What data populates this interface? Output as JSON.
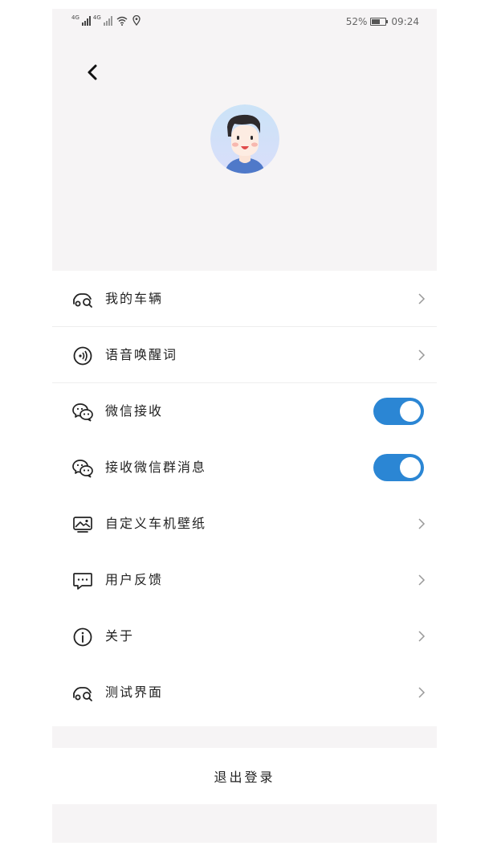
{
  "status_bar": {
    "network_1": "4G",
    "network_2": "4G",
    "battery_level": "52%",
    "battery_fraction": 0.52,
    "time": "09:24"
  },
  "header": {
    "back_icon": "chevron-left-icon",
    "avatar_icon": "user-avatar-illustration"
  },
  "menu": {
    "items": [
      {
        "label": "我的车辆",
        "icon": "car-search-icon",
        "control": "chevron"
      },
      {
        "label": "语音唤醒词",
        "icon": "voice-wake-icon",
        "control": "chevron"
      },
      {
        "label": "微信接收",
        "icon": "wechat-icon",
        "control": "toggle",
        "toggle_on": true
      },
      {
        "label": "接收微信群消息",
        "icon": "wechat-icon",
        "control": "toggle",
        "toggle_on": true
      },
      {
        "label": "自定义车机壁纸",
        "icon": "wallpaper-icon",
        "control": "chevron"
      },
      {
        "label": "用户反馈",
        "icon": "feedback-icon",
        "control": "chevron"
      },
      {
        "label": "关于",
        "icon": "info-icon",
        "control": "chevron"
      },
      {
        "label": "测试界面",
        "icon": "car-search-icon",
        "control": "chevron"
      }
    ]
  },
  "logout": {
    "label": "退出登录"
  },
  "colors": {
    "accent": "#2b86d4",
    "header_bg": "#f6f4f5",
    "divider": "#ededed"
  }
}
